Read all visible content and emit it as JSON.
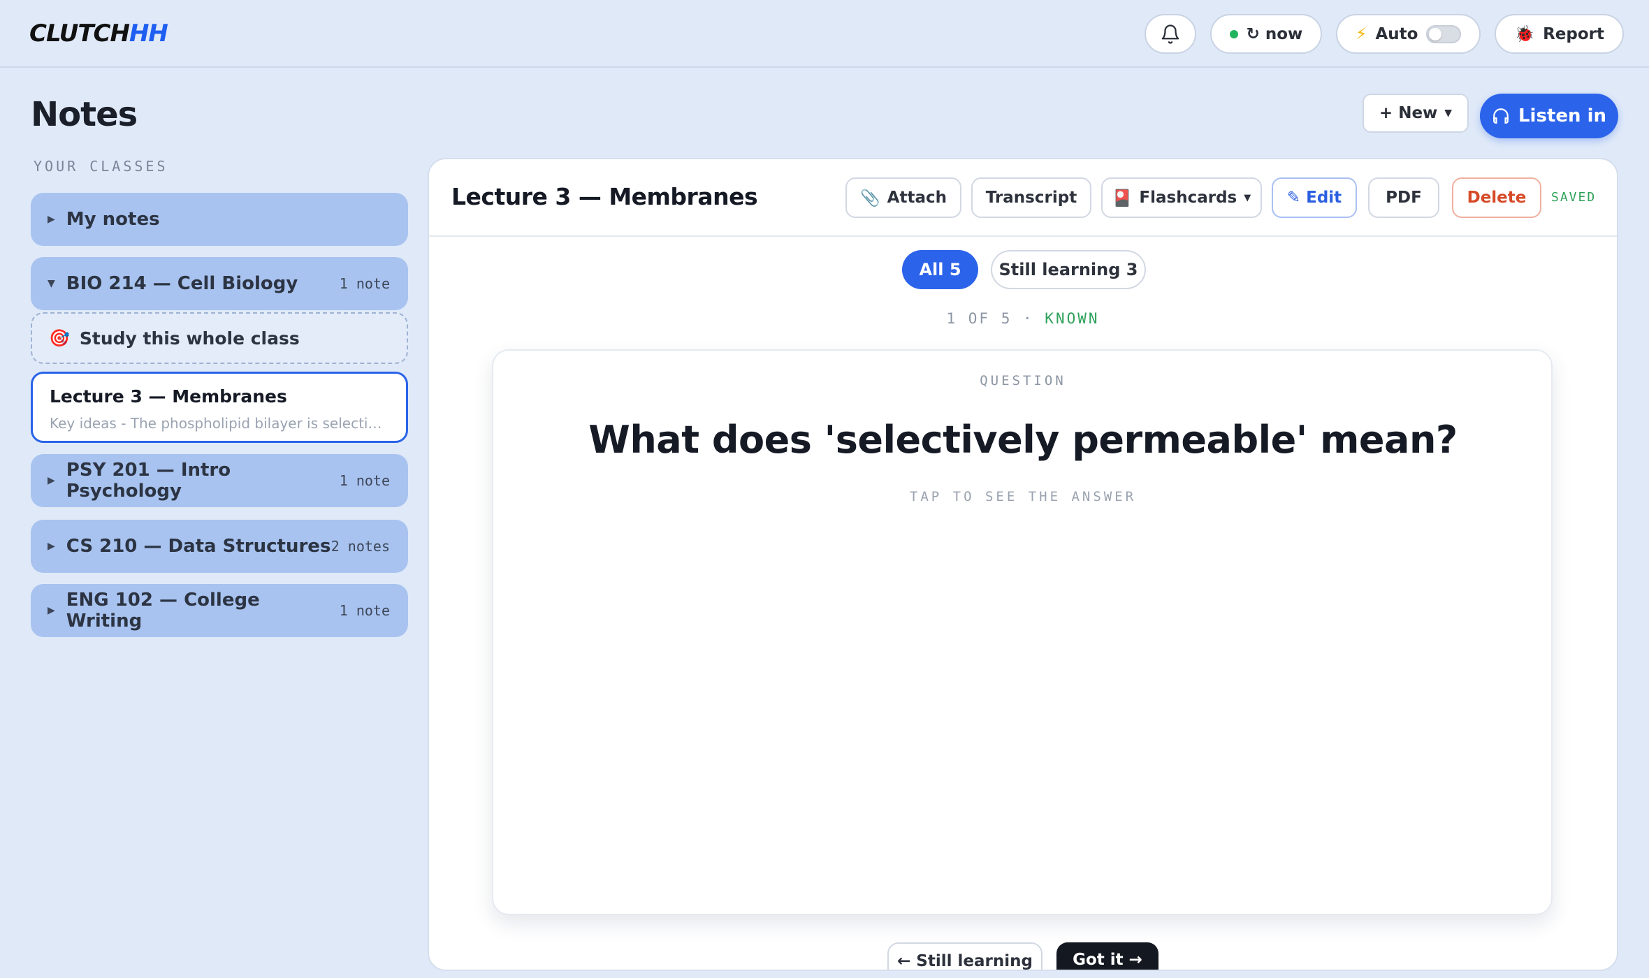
{
  "app": {
    "logo_main": "CLUTCH",
    "logo_accent": "HH"
  },
  "topbar": {
    "sync_label": "↻ now",
    "auto_label": "Auto",
    "auto_enabled": false,
    "report_label": "Report"
  },
  "page": {
    "title": "Notes",
    "section_label": "YOUR CLASSES"
  },
  "sidebar": {
    "my_notes": "My notes",
    "classes": [
      {
        "label": "BIO 214 — Cell Biology",
        "count": "1 note",
        "expanded": true
      },
      {
        "label": "PSY 201 — Intro Psychology",
        "count": "1 note",
        "expanded": false
      },
      {
        "label": "CS 210 — Data Structures",
        "count": "2 notes",
        "expanded": false
      },
      {
        "label": "ENG 102 — College Writing",
        "count": "1 note",
        "expanded": false
      }
    ],
    "study_label": "Study this whole class",
    "active_note": {
      "title": "Lecture 3 — Membranes",
      "snippet": "Key ideas - The phospholipid bilayer is selectively permeable"
    }
  },
  "actions": {
    "new_label": "+ New",
    "listen_label": "Listen in"
  },
  "note": {
    "title": "Lecture 3 — Membranes",
    "buttons": {
      "attach": "Attach",
      "transcript": "Transcript",
      "flashcards": "Flashcards",
      "edit": "✎ Edit",
      "pdf": "PDF",
      "delete": "Delete"
    },
    "saved_status": "SAVED"
  },
  "flashcards": {
    "filter_all": "All 5",
    "filter_learning": "Still learning 3",
    "position": "1 OF 5 ·",
    "status": "KNOWN",
    "side_label": "QUESTION",
    "question": "What does 'selectively permeable' mean?",
    "hint": "TAP TO SEE THE ANSWER",
    "still_learning_btn": "← Still learning",
    "got_it_btn": "Got it →"
  },
  "colors": {
    "accent": "#2b63ea",
    "background": "#dfe9f8",
    "class_bg": "#a8c3ef",
    "success": "#2ea15a",
    "danger": "#d64a28"
  }
}
